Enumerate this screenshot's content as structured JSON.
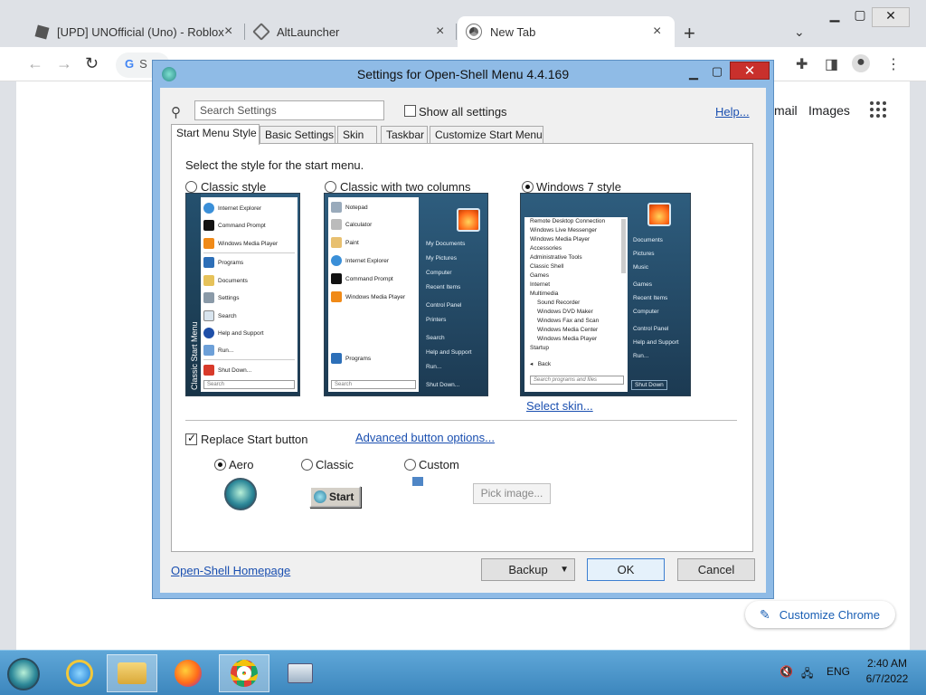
{
  "browser": {
    "tabs": [
      {
        "title": "[UPD] UNOfficial (Uno) - Roblox",
        "active": false
      },
      {
        "title": "AltLauncher",
        "active": false
      },
      {
        "title": "New Tab",
        "active": true
      }
    ],
    "new_tab_icon": "+",
    "tab_search_icon": "⌄",
    "omnibox_text": "S",
    "gmail_label": "mail",
    "images_label": "Images",
    "customize_label": "Customize Chrome"
  },
  "dialog": {
    "title": "Settings for Open-Shell Menu 4.4.169",
    "search_placeholder": "Search Settings",
    "show_all_label": "Show all settings",
    "show_all_checked": false,
    "help_label": "Help...",
    "tabs": [
      "Start Menu Style",
      "Basic Settings",
      "Skin",
      "Taskbar",
      "Customize Start Menu"
    ],
    "active_tab": "Start Menu Style",
    "select_style_label": "Select the style for the start menu.",
    "styles": [
      {
        "label": "Classic style",
        "selected": false
      },
      {
        "label": "Classic with two columns",
        "selected": false
      },
      {
        "label": "Windows 7 style",
        "selected": true
      }
    ],
    "classic_preview": {
      "band_label": "Classic Start Menu",
      "items": [
        "Internet Explorer",
        "Command Prompt",
        "Windows Media Player",
        "Programs",
        "Documents",
        "Settings",
        "Search",
        "Help and Support",
        "Run...",
        "Shut Down..."
      ],
      "search_placeholder": "Search"
    },
    "two_column_preview": {
      "left_items": [
        "Notepad",
        "Calculator",
        "Paint",
        "Internet Explorer",
        "Command Prompt",
        "Windows Media Player"
      ],
      "programs_label": "Programs",
      "right_items": [
        "My Documents",
        "My Pictures",
        "Computer",
        "Recent Items",
        "Control Panel",
        "Printers",
        "Search",
        "Help and Support",
        "Run...",
        "Shut Down..."
      ],
      "search_placeholder": "Search"
    },
    "win7_preview": {
      "left_items": [
        "Remote Desktop Connection",
        "Windows Live Messenger",
        "Windows Media Player",
        "Accessories",
        "Administrative Tools",
        "Classic Shell",
        "Games",
        "Internet",
        "Multimedia",
        "Sound Recorder",
        "Windows DVD Maker",
        "Windows Fax and Scan",
        "Windows Media Center",
        "Windows Media Player",
        "Startup"
      ],
      "back_label": "Back",
      "search_placeholder": "Search programs and files",
      "right_items": [
        "Documents",
        "Pictures",
        "Music",
        "Games",
        "Recent Items",
        "Computer",
        "Control Panel",
        "Help and Support",
        "Run..."
      ],
      "shutdown_label": "Shut Down"
    },
    "select_skin_label": "Select skin...",
    "replace_start_label": "Replace Start button",
    "replace_start_checked": true,
    "advanced_button_label": "Advanced button options...",
    "button_styles": [
      {
        "label": "Aero",
        "selected": true
      },
      {
        "label": "Classic",
        "selected": false
      },
      {
        "label": "Custom",
        "selected": false
      }
    ],
    "classic_start_label": "Start",
    "pick_image_label": "Pick image...",
    "homepage_label": "Open-Shell Homepage",
    "backup_label": "Backup",
    "ok_label": "OK",
    "cancel_label": "Cancel"
  },
  "taskbar": {
    "language": "ENG",
    "time": "2:40 AM",
    "date": "6/7/2022"
  },
  "colors": {
    "accent_link": "#1a4fb0",
    "dialog_frame": "#8fbbe6",
    "close_red": "#c9302c",
    "taskbar": "#3c86bd"
  }
}
